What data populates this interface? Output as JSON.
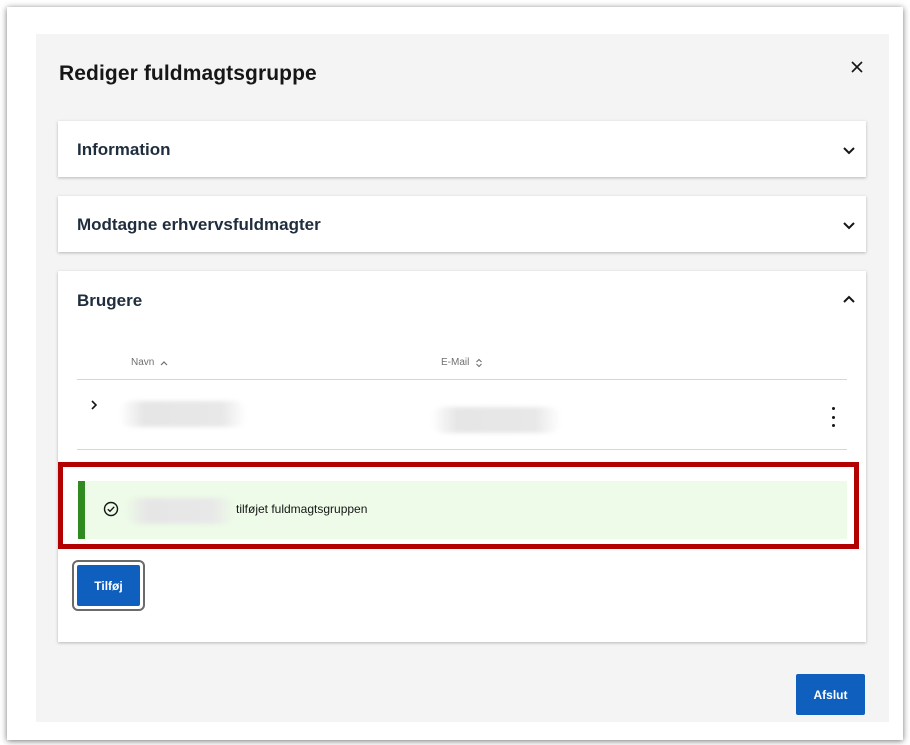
{
  "modal": {
    "title": "Rediger fuldmagtsgruppe",
    "close_icon": "close-icon"
  },
  "sections": {
    "information": {
      "title": "Information",
      "expanded": false
    },
    "received": {
      "title": "Modtagne erhvervsfuldmagter",
      "expanded": false
    },
    "users": {
      "title": "Brugere",
      "expanded": true,
      "table": {
        "columns": [
          {
            "label": "Navn",
            "sort": "ascending",
            "sort_icon": "chevron-up-icon"
          },
          {
            "label": "E-Mail",
            "sort": "none",
            "sort_icon": "sort-icon"
          }
        ],
        "rows": [
          {
            "name": "",
            "email": "",
            "redacted": true
          }
        ]
      },
      "notification": {
        "icon": "checkmark-circle-icon",
        "message": "tilføjet fuldmagtsgruppen",
        "accent": "#2f8a1f",
        "background": "#eefbe8"
      },
      "add_button": "Tilføj"
    }
  },
  "footer": {
    "finish_button": "Afslut"
  },
  "colors": {
    "primary": "#0f5fbf",
    "highlight": "#b30000",
    "background": "#f4f4f4"
  }
}
